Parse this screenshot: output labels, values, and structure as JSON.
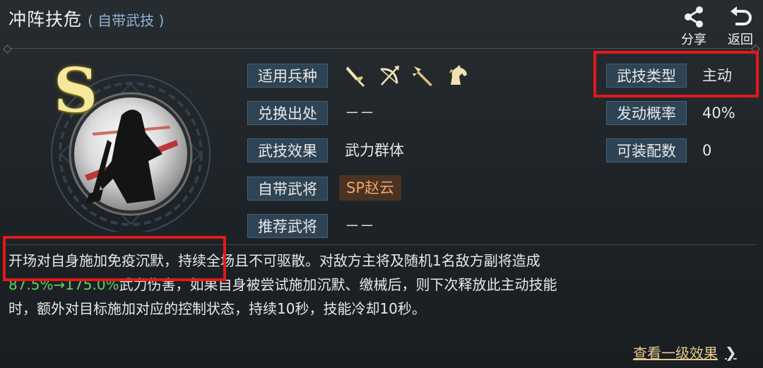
{
  "header": {
    "title": "冲阵扶危",
    "subtitle": "( 自带武技 )",
    "share_label": "分享",
    "back_label": "返回"
  },
  "skill": {
    "grade": "S",
    "troop_icons": [
      "sword-icon",
      "bow-icon",
      "spear-icon",
      "horse-icon"
    ]
  },
  "left_fields": {
    "troops_label": "适用兵种",
    "source_label": "兑换出处",
    "source_value": "－－",
    "effect_label": "武技效果",
    "effect_value": "武力群体",
    "general_label": "自带武将",
    "general_value": "SP赵云",
    "recommend_label": "推荐武将",
    "recommend_value": "－－"
  },
  "right_fields": {
    "type_label": "武技类型",
    "type_value": "主动",
    "chance_label": "发动概率",
    "chance_value": "40%",
    "equip_label": "可装配数",
    "equip_value": "0"
  },
  "description": {
    "line1": "开场对自身施加免疫沉默，持续全场且不可驱散。对敌方主将及随机1名敌方副将造成",
    "highlight": "87.5%→175.0%",
    "line2_rest": "武力伤害，如果自身被尝试施加沉默、缴械后，则下次释放此主动技能",
    "line3": "时，额外对目标施加对应的控制状态，持续10秒，技能冷却10秒。"
  },
  "footer": {
    "more_label": "查看一级效果",
    "more_chevron": "❯"
  },
  "colors": {
    "label_bg": "#2e4454",
    "highlight_green": "#5fd35f",
    "annotation_red": "#e01a1a",
    "general_badge_text": "#f0a46a",
    "grade_gold": "#f5e89a"
  }
}
